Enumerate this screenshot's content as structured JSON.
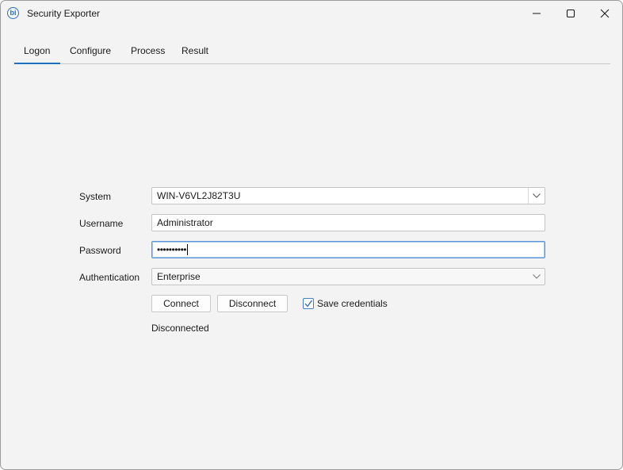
{
  "window": {
    "title": "Security Exporter",
    "app_icon_glyph": "bi"
  },
  "tabs": [
    {
      "label": "Logon",
      "active": true
    },
    {
      "label": "Configure",
      "active": false
    },
    {
      "label": "Process",
      "active": false
    },
    {
      "label": "Result",
      "active": false
    }
  ],
  "form": {
    "system": {
      "label": "System",
      "value": "WIN-V6VL2J82T3U"
    },
    "username": {
      "label": "Username",
      "value": "Administrator"
    },
    "password": {
      "label": "Password",
      "value": "••••••••••"
    },
    "authentication": {
      "label": "Authentication",
      "value": "Enterprise"
    }
  },
  "actions": {
    "connect_label": "Connect",
    "disconnect_label": "Disconnect",
    "save_credentials_label": "Save credentials",
    "save_credentials_checked": true
  },
  "status": {
    "text": "Disconnected"
  },
  "colors": {
    "accent": "#1f6fbf",
    "window_bg": "#f3f3f3"
  }
}
